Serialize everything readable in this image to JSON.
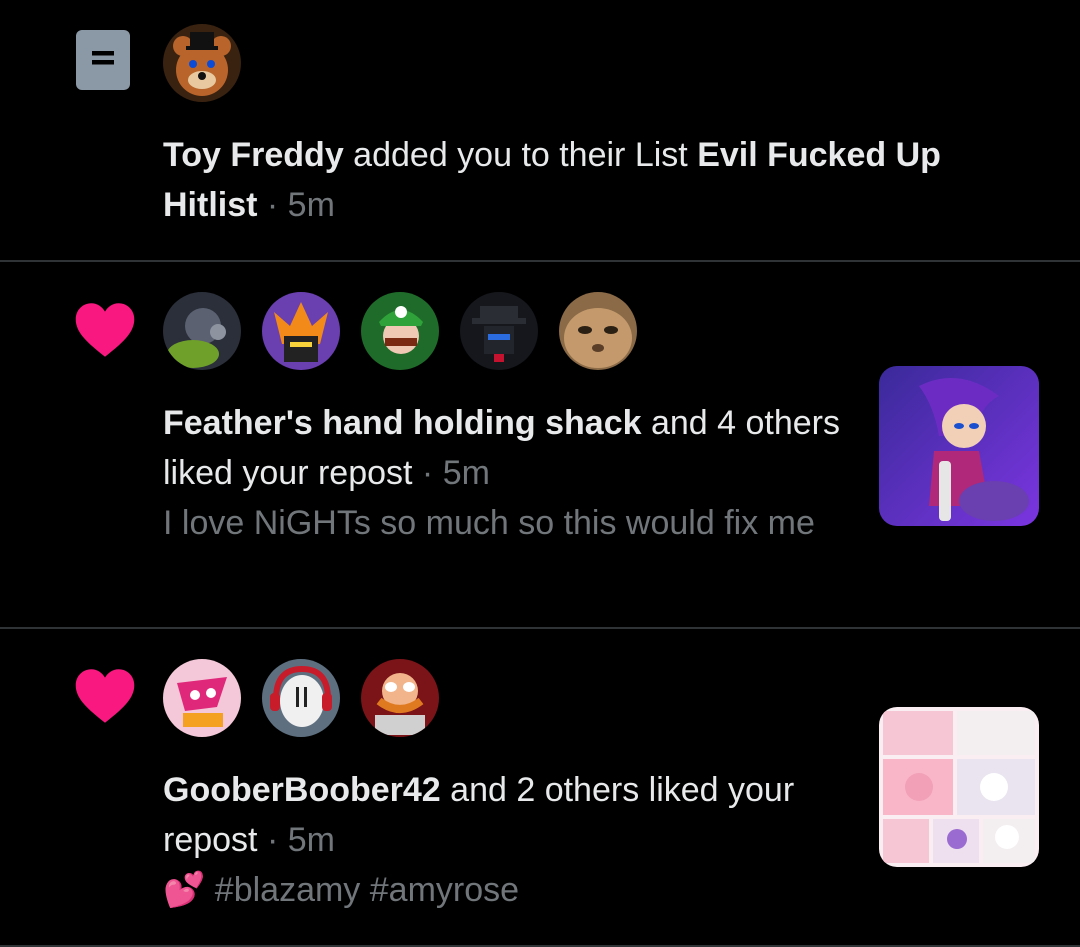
{
  "notifications": [
    {
      "type": "list-add",
      "icon": "list-icon",
      "actor": "Toy Freddy",
      "action_text": " added you to their List ",
      "list_name": "Evil Fucked Up Hitlist",
      "separator": " · ",
      "time": "5m",
      "avatars": [
        "toy-freddy-avatar"
      ]
    },
    {
      "type": "like",
      "icon": "heart-icon",
      "actor": "Feather's hand holding shack",
      "action_text": " and 4 others liked your repost",
      "separator": " · ",
      "time": "5m",
      "post_text": "I love NiGHTs so much so this would fix me",
      "avatars": [
        "avatar-1",
        "avatar-2",
        "avatar-3",
        "avatar-4",
        "avatar-5"
      ],
      "thumbnail": "nights-thumbnail"
    },
    {
      "type": "like",
      "icon": "heart-icon",
      "actor": "GooberBoober42",
      "action_text": " and 2 others liked your repost",
      "separator": " · ",
      "time": "5m",
      "post_emoji": "💕",
      "post_text": " #blazamy #amyrose",
      "avatars": [
        "avatar-1",
        "avatar-2",
        "avatar-3"
      ],
      "thumbnail": "comic-thumbnail"
    }
  ],
  "colors": {
    "background": "#000000",
    "text": "#e7e9ea",
    "muted": "#71767b",
    "heart": "#f91880",
    "divider": "#2f3336",
    "list_icon": "#8b98a5"
  }
}
